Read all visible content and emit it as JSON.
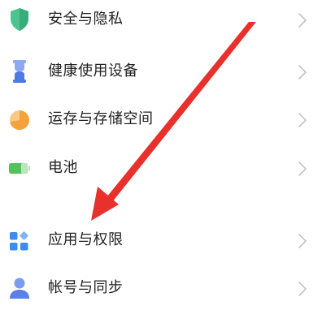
{
  "settings": {
    "items": [
      {
        "label": "安全与隐私",
        "icon": "shield-icon"
      },
      {
        "label": "健康使用设备",
        "icon": "hourglass-icon"
      },
      {
        "label": "运存与存储空间",
        "icon": "pie-chart-icon"
      },
      {
        "label": "电池",
        "icon": "battery-icon"
      },
      {
        "label": "应用与权限",
        "icon": "apps-grid-icon"
      },
      {
        "label": "帐号与同步",
        "icon": "user-icon"
      }
    ]
  },
  "colors": {
    "label_text": "#222222",
    "chevron": "#c4c4c4",
    "shield": "#4cc48f",
    "hourglass": "#4f78e8",
    "pie": "#f5a23c",
    "battery": "#54c25a",
    "apps": "#3b8cf0",
    "user": "#5b7fe9",
    "annotation_arrow": "#e8302c"
  }
}
